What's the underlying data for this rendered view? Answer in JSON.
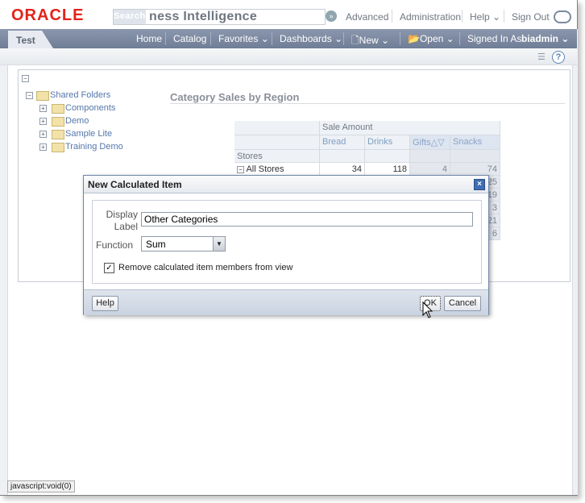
{
  "header": {
    "logo": "ORACLE",
    "search_scope": "Search",
    "app_title": "ness Intelligence",
    "links": [
      "Advanced",
      "Administration",
      "Help",
      "Sign Out"
    ]
  },
  "nav": {
    "tab": "Test",
    "items": [
      "Home",
      "Catalog",
      "Favorites",
      "Dashboards",
      "New",
      "Open"
    ],
    "signed_in_label": "Signed In As",
    "user": "biadmin"
  },
  "tree": {
    "root": "Shared Folders",
    "children": [
      "Components",
      "Demo",
      "Sample Lite",
      "Training Demo"
    ]
  },
  "report": {
    "title": "Category Sales by Region",
    "measure": "Sale Amount",
    "columns": [
      "Bread",
      "Drinks",
      "Gifts",
      "Snacks"
    ],
    "row_header": "Stores",
    "first_row_label": "All Stores",
    "first_row_values": [
      "34",
      "118",
      "4",
      "74"
    ],
    "partial_values": [
      "25",
      "19",
      "3",
      "21",
      "6"
    ]
  },
  "dialog": {
    "title": "New Calculated Item",
    "display_label_label": "Display Label",
    "display_label_value": "Other Categories",
    "function_label": "Function",
    "function_value": "Sum",
    "checkbox_label": "Remove calculated item members from view",
    "checkbox_checked": true,
    "help_button": "Help",
    "ok_button": "OK",
    "cancel_button": "Cancel"
  },
  "status_bar": "javascript:void(0)",
  "colors": {
    "oracle_red": "#e2231a",
    "nav_bar": "#7b88a1",
    "link_blue": "#5577aa"
  }
}
